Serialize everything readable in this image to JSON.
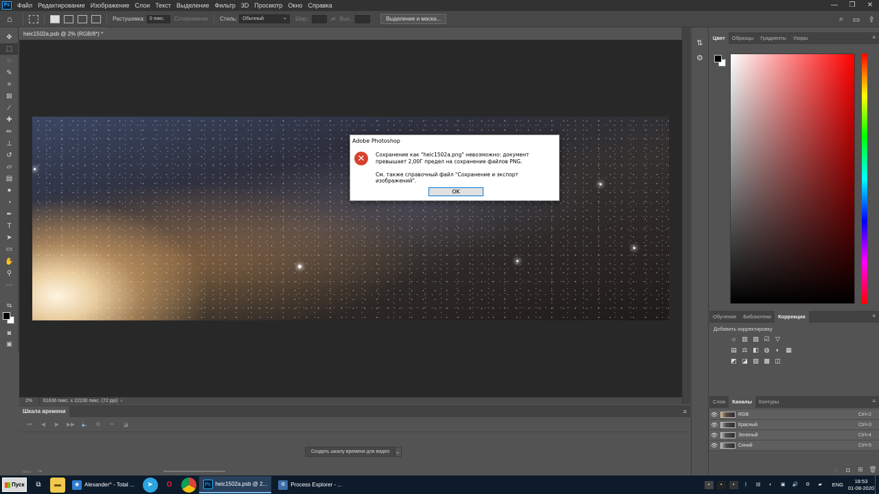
{
  "app": {
    "logo": "Ps"
  },
  "menu": [
    "Файл",
    "Редактирование",
    "Изображение",
    "Слои",
    "Текст",
    "Выделение",
    "Фильтр",
    "3D",
    "Просмотр",
    "Окно",
    "Справка"
  ],
  "window_buttons": [
    "—",
    "❐",
    "✕"
  ],
  "options": {
    "feather_label": "Растушевка:",
    "feather_value": "0 пикс.",
    "antialias_label": "Сглаживание",
    "style_label": "Стиль:",
    "style_value": "Обычный",
    "width_label": "Шир.:",
    "height_label": "Выс.:",
    "select_mask_button": "Выделение и маска..."
  },
  "document": {
    "tab_title": "heic1502a.psb @ 2% (RGB/8*) *",
    "close": "×",
    "zoom": "2%",
    "size_info": "61636 пикс. x 22230 пикс. (72 ppi)",
    "status_arrow": "›"
  },
  "timeline": {
    "tab": "Шкала времени",
    "create_button": "Создать шкалу времени для видео",
    "controls": [
      "⏮",
      "◀",
      "▶",
      "▶▶",
      "🔈",
      "⚙",
      "✂",
      "◪"
    ]
  },
  "panels": {
    "color_tabs": [
      "Цвет",
      "Образцы",
      "Градиенты",
      "Узоры"
    ],
    "adjust_tabs": [
      "Обучение",
      "Библиотеки",
      "Коррекция"
    ],
    "adjust_title": "Добавить корректировку",
    "adjust_icons_row1": [
      "☼",
      "▥",
      "▧",
      "☑",
      "▽"
    ],
    "adjust_icons_row2": [
      "▤",
      "⚖",
      "◧",
      "◍",
      "◐",
      "▦"
    ],
    "adjust_icons_row3": [
      "◩",
      "◪",
      "▨",
      "▩",
      "◫"
    ],
    "channels_tabs": [
      "Слои",
      "Каналы",
      "Контуры"
    ],
    "channels": [
      {
        "name": "RGB",
        "key": "Ctrl+2"
      },
      {
        "name": "Красный",
        "key": "Ctrl+3"
      },
      {
        "name": "Зеленый",
        "key": "Ctrl+4"
      },
      {
        "name": "Синий",
        "key": "Ctrl+5"
      }
    ]
  },
  "dialog": {
    "title": "Adobe Photoshop",
    "message": "Сохранение как \"heic1502a.png\" невозможно: документ превышает 2,00Г предел на сохранение файлов PNG.",
    "message2": "См. также справочный файл \"Сохранение и экспорт изображений\".",
    "ok": "OK",
    "icon": "✕"
  },
  "taskbar": {
    "start": "Пуск",
    "apps": [
      {
        "label": "Alexander^ - Total ...",
        "icon": "◉",
        "color": "#2f7fd1",
        "active": false
      },
      {
        "label": "heic1502a.psb @ 2...",
        "icon": "Ps",
        "color": "#001e36",
        "active": true
      },
      {
        "label": "Process Explorer - ...",
        "icon": "⚙",
        "color": "#3b6ea8",
        "active": false
      }
    ],
    "lang": "ENG",
    "time": "18:53",
    "date": "01-08-2020"
  },
  "colors": {
    "accent": "#31a8ff",
    "error": "#d8402b",
    "ok_border": "#0078d7"
  }
}
